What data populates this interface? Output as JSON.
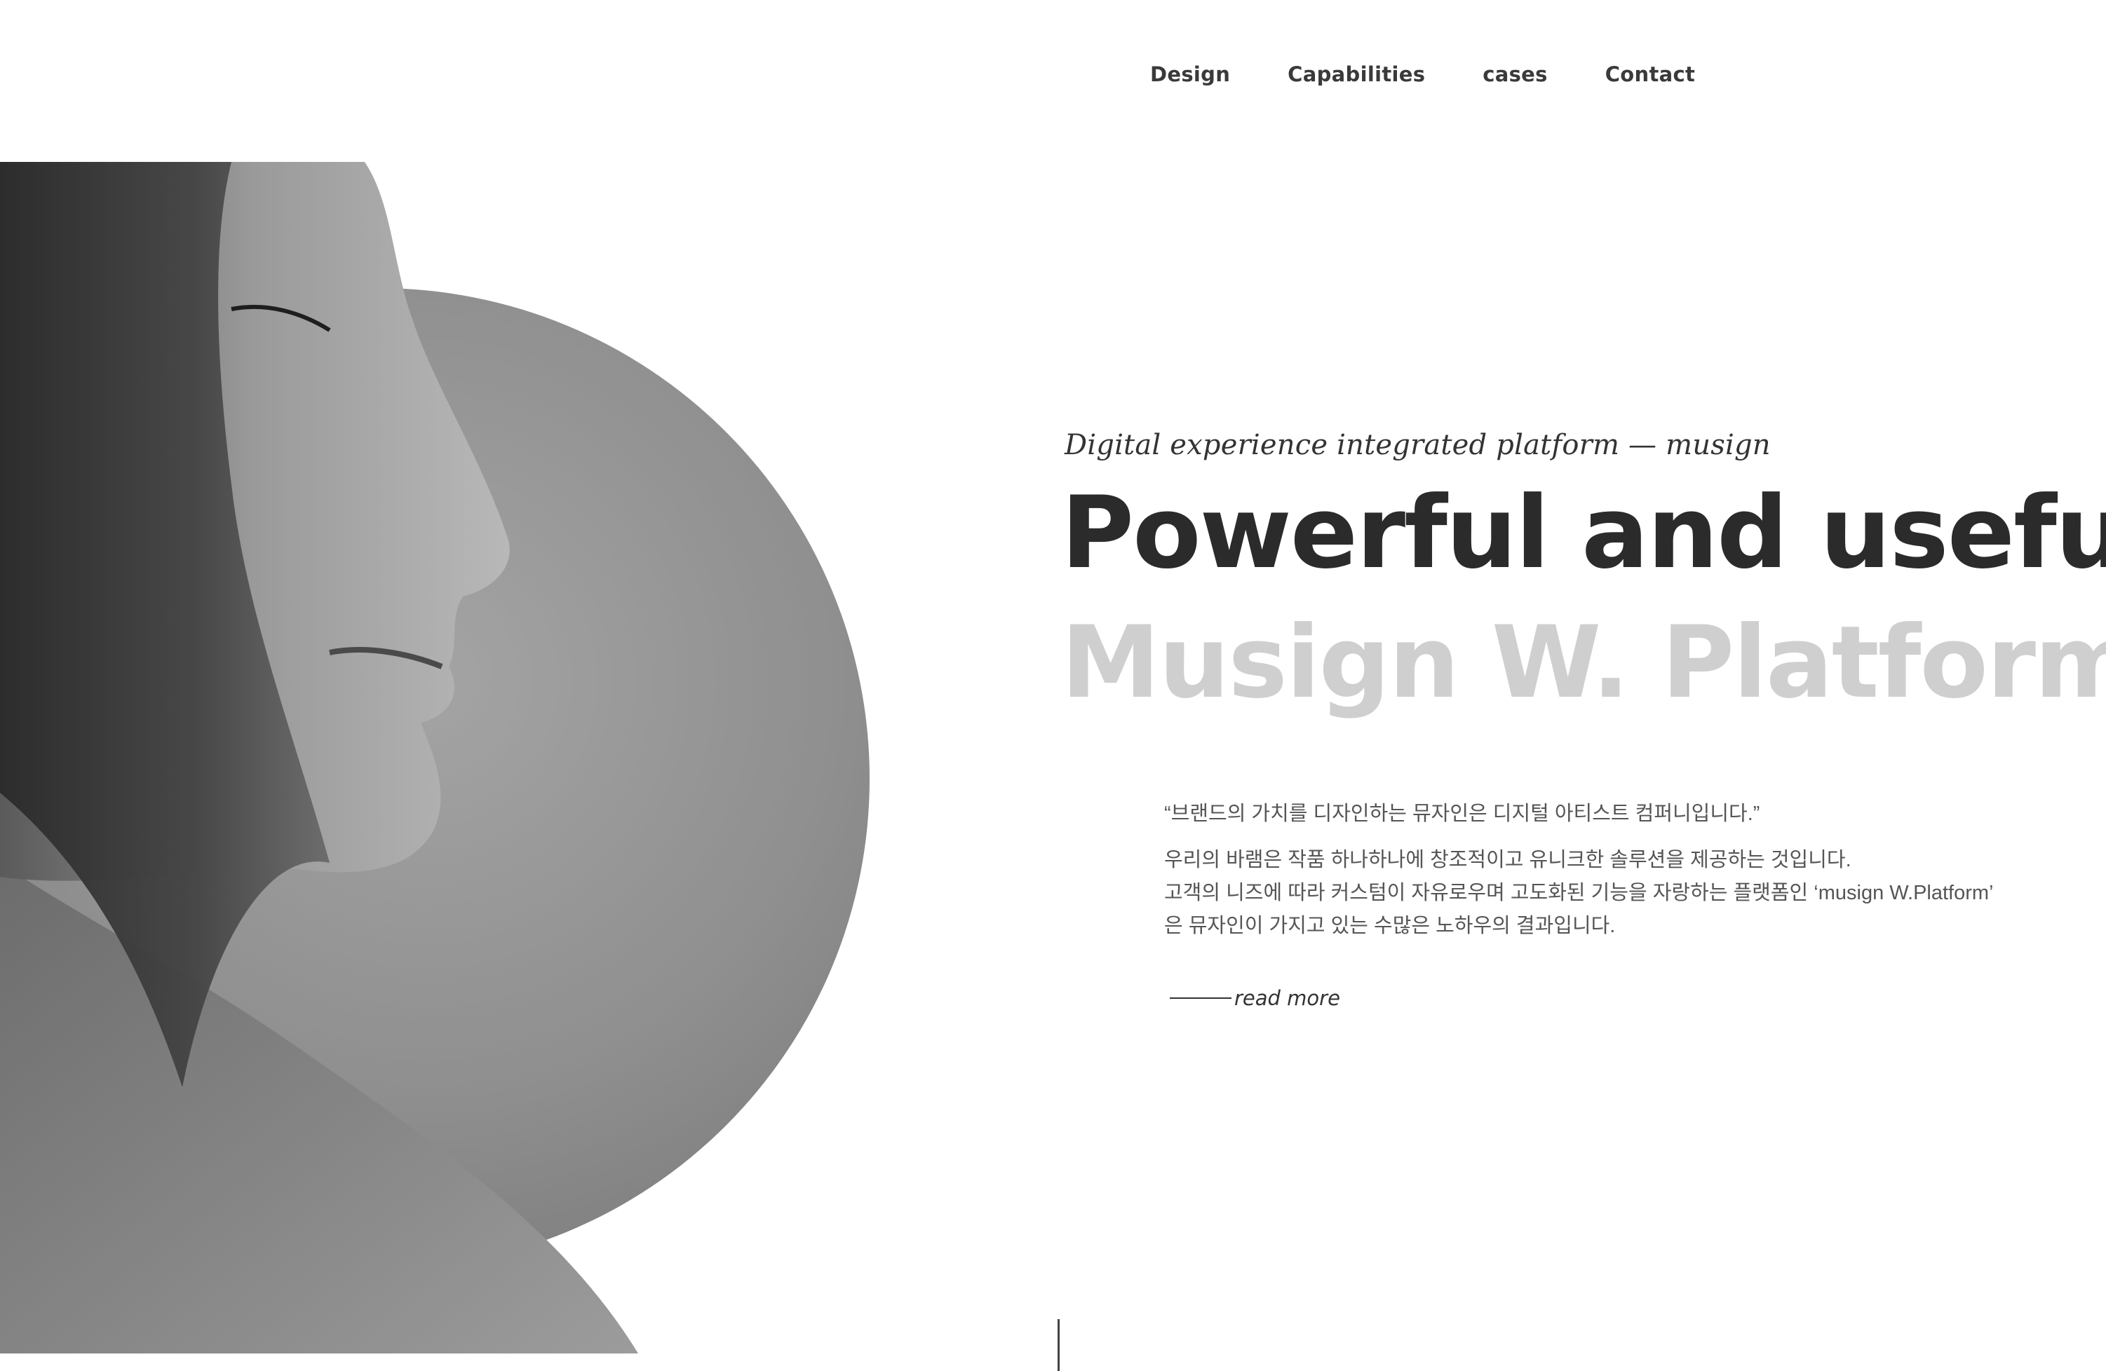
{
  "nav": {
    "items": [
      {
        "label": "Design"
      },
      {
        "label": "Capabilities"
      },
      {
        "label": "cases"
      },
      {
        "label": "Contact"
      }
    ]
  },
  "hero": {
    "eyebrow": "Digital experience integrated platform — musign",
    "headline": "Powerful and useful",
    "subheadline": "Musign W. Platform",
    "quote": "“브랜드의 가치를 디자인하는 뮤자인은 디지털 아티스트 컴퍼니입니다.”",
    "description_lines": [
      "우리의 바램은 작품 하나하나에 창조적이고 유니크한 솔루션을 제공하는 것입니다.",
      "고객의 니즈에 따라 커스텀이 자유로우며 고도화된 기능을 자랑하는 플랫폼인 ‘musign W.Platform’",
      "은 뮤자인이 가지고 있는 수많은 노하우의 결과입니다."
    ],
    "read_more_label": "read more"
  },
  "colors": {
    "headline": "#2b2b2b",
    "subheadline": "#cfcfcf",
    "body_text": "#555555",
    "circle": "#8e8e8e"
  }
}
